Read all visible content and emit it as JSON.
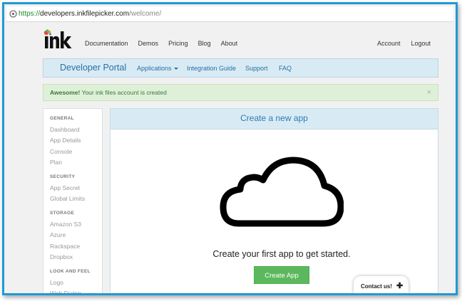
{
  "browser": {
    "url_scheme": "https://",
    "url_host": "developers.inkfilepicker.com",
    "url_path": "/welcome/"
  },
  "topnav": {
    "logo_text": "ink",
    "items": [
      "Documentation",
      "Demos",
      "Pricing",
      "Blog",
      "About"
    ],
    "right_items": [
      "Account",
      "Logout"
    ]
  },
  "portal": {
    "brand": "Developer Portal",
    "items": [
      "Applications",
      "Integration Guide",
      "Support",
      "FAQ"
    ]
  },
  "alert": {
    "strong": "Awesome!",
    "text": " Your ink files account is created",
    "close": "×"
  },
  "sidebar": {
    "sections": [
      {
        "title": "GENERAL",
        "links": [
          "Dashboard",
          "App Details",
          "Console",
          "Plan"
        ]
      },
      {
        "title": "SECURITY",
        "links": [
          "App Secret",
          "Global Limits"
        ]
      },
      {
        "title": "STORAGE",
        "links": [
          "Amazon S3",
          "Azure",
          "Rackspace",
          "Dropbox"
        ]
      },
      {
        "title": "LOOK AND FEEL",
        "links": [
          "Logo",
          "Web Dialog"
        ]
      }
    ]
  },
  "main": {
    "title": "Create a new app",
    "icon": "cloud-icon",
    "prompt": "Create your first app to get started.",
    "button": "Create App"
  },
  "contact": {
    "label": "Contact us!",
    "plus": "✚"
  },
  "colors": {
    "frame": "#1f9ad6",
    "portal_bg": "#d8ebf5",
    "portal_text": "#2a6fa3",
    "alert_bg": "#dff0d8",
    "alert_text": "#3c763d",
    "button": "#5cb85c"
  }
}
